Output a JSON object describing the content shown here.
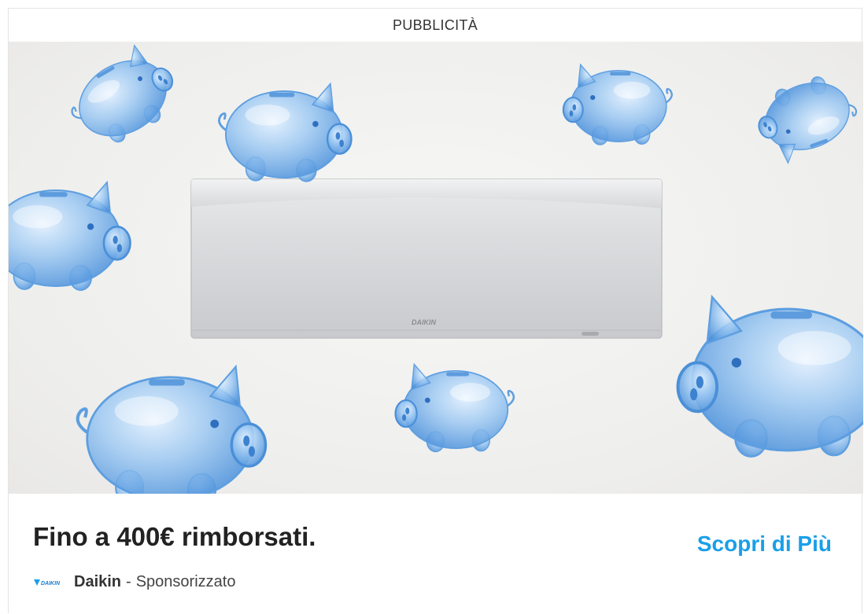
{
  "ad": {
    "label": "PUBBLICITÀ",
    "headline": "Fino a 400€ rimborsati.",
    "advertiser": "Daikin",
    "separator": "-",
    "sponsored": "Sponsorizzato",
    "cta": "Scopri di Più",
    "brand_mark": "DAIKIN"
  },
  "colors": {
    "cta": "#1a9fe8",
    "pig": "#7fb7ec",
    "unit": "#d3d4d6"
  }
}
